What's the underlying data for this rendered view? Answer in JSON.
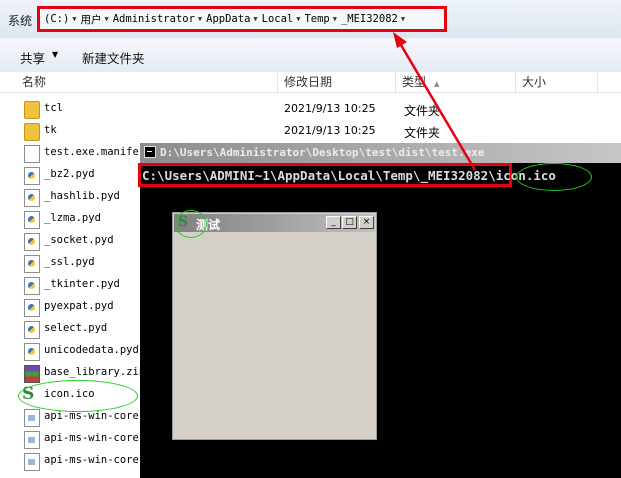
{
  "address_bar": {
    "prefix": "系统",
    "crumbs": [
      "(C:)",
      "用户",
      "Administrator",
      "AppData",
      "Local",
      "Temp",
      "_MEI32082"
    ]
  },
  "toolbar": {
    "share_label": "共享",
    "new_folder_label": "新建文件夹"
  },
  "columns": {
    "name": "名称",
    "date": "修改日期",
    "type": "类型",
    "size": "大小"
  },
  "files": [
    {
      "name": "tcl",
      "date": "2021/9/13 10:25",
      "type": "文件夹",
      "icon": "folder-icon"
    },
    {
      "name": "tk",
      "date": "2021/9/13 10:25",
      "type": "文件夹",
      "icon": "folder-icon"
    },
    {
      "name": "test.exe.manifest",
      "date": "",
      "type": "",
      "icon": "document-icon"
    },
    {
      "name": "_bz2.pyd",
      "date": "",
      "type": "",
      "icon": "python-file-icon"
    },
    {
      "name": "_hashlib.pyd",
      "date": "",
      "type": "",
      "icon": "python-file-icon"
    },
    {
      "name": "_lzma.pyd",
      "date": "",
      "type": "",
      "icon": "python-file-icon"
    },
    {
      "name": "_socket.pyd",
      "date": "",
      "type": "",
      "icon": "python-file-icon"
    },
    {
      "name": "_ssl.pyd",
      "date": "",
      "type": "",
      "icon": "python-file-icon"
    },
    {
      "name": "_tkinter.pyd",
      "date": "",
      "type": "",
      "icon": "python-file-icon"
    },
    {
      "name": "pyexpat.pyd",
      "date": "",
      "type": "",
      "icon": "python-file-icon"
    },
    {
      "name": "select.pyd",
      "date": "",
      "type": "",
      "icon": "python-file-icon"
    },
    {
      "name": "unicodedata.pyd",
      "date": "",
      "type": "",
      "icon": "python-file-icon"
    },
    {
      "name": "base_library.zip",
      "date": "",
      "type": "",
      "icon": "zip-archive-icon"
    },
    {
      "name": "icon.ico",
      "date": "",
      "type": "",
      "icon": "s-logo-icon"
    },
    {
      "name": "api-ms-win-core-",
      "date": "",
      "type": "",
      "icon": "dll-file-icon"
    },
    {
      "name": "api-ms-win-core-",
      "date": "",
      "type": "",
      "icon": "dll-file-icon"
    },
    {
      "name": "api-ms-win-core-",
      "date": "",
      "type": "",
      "icon": "dll-file-icon"
    }
  ],
  "console": {
    "title": "D:\\Users\\Administrator\\Desktop\\test\\dist\\test.exe",
    "path_highlight": "C:\\Users\\ADMINI~1\\AppData\\Local\\Temp\\_MEI32082",
    "path_rest": "\\icon.ico"
  },
  "app_window": {
    "title": "测试",
    "minimize_label": "_",
    "maximize_label": "□",
    "close_label": "×"
  },
  "colors": {
    "highlight_box": "#e60012",
    "annotation_ellipse": "#22cc22",
    "console_bg": "#000000"
  }
}
